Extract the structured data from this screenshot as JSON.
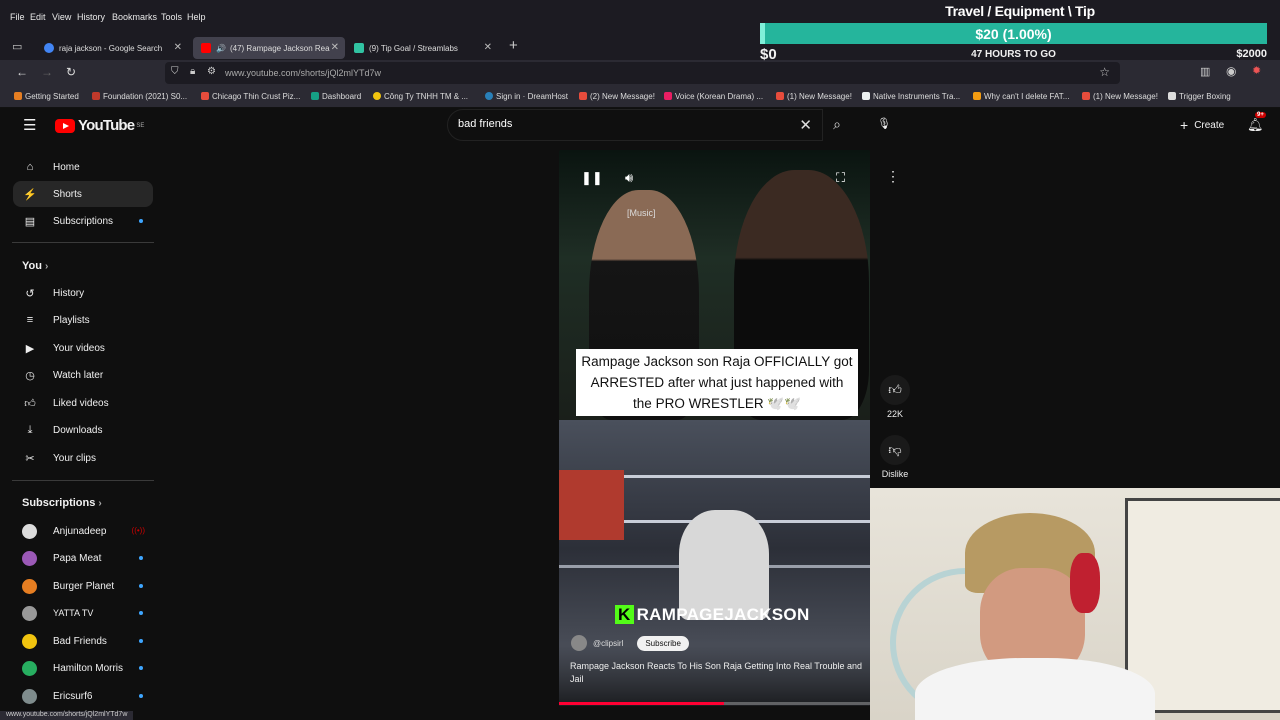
{
  "browser": {
    "menu": [
      "File",
      "Edit",
      "View",
      "History",
      "Bookmarks",
      "Tools",
      "Help"
    ],
    "tabs": [
      {
        "title": "raja jackson - Google Search",
        "active": false
      },
      {
        "title": "(47) Rampage Jackson Rea",
        "active": true
      },
      {
        "title": "(9) Tip Goal / Streamlabs",
        "active": false
      }
    ],
    "url": "www.youtube.com/shorts/jQl2mlYTd7w",
    "bookmarks": [
      "Getting Started",
      "Foundation (2021) S0...",
      "Chicago Thin Crust Piz...",
      "Dashboard",
      "Công Ty TNHH TM & ...",
      "Sign in · DreamHost",
      "(2) New Message!",
      "Voice (Korean Drama) ...",
      "(1) New Message!",
      "Native Instruments Tra...",
      "Why can't I delete FAT...",
      "(1) New Message!",
      "Trigger Boxing"
    ],
    "status_url": "www.youtube.com/shorts/jQl2mlYTd7w"
  },
  "overlay": {
    "title": "Travel / Equipment \\ Tip",
    "amount": "$20 (1.00%)",
    "progress": 0.01,
    "min": "$0",
    "max": "$2000",
    "time_left": "47 HOURS TO GO"
  },
  "header": {
    "logo": "YouTube",
    "logo_region": "SE",
    "search_value": "bad friends",
    "create_label": "Create",
    "notif_count": "9+"
  },
  "sidebar": {
    "main": [
      {
        "label": "Home",
        "icon": "home-icon"
      },
      {
        "label": "Shorts",
        "icon": "shorts-icon"
      },
      {
        "label": "Subscriptions",
        "icon": "subscriptions-icon"
      }
    ],
    "you_label": "You",
    "you_items": [
      {
        "label": "History",
        "icon": "history-icon"
      },
      {
        "label": "Playlists",
        "icon": "playlists-icon"
      },
      {
        "label": "Your videos",
        "icon": "your-videos-icon"
      },
      {
        "label": "Watch later",
        "icon": "watch-later-icon"
      },
      {
        "label": "Liked videos",
        "icon": "liked-videos-icon"
      },
      {
        "label": "Downloads",
        "icon": "downloads-icon"
      },
      {
        "label": "Your clips",
        "icon": "clips-icon"
      }
    ],
    "subs_label": "Subscriptions",
    "subs": [
      {
        "label": "Anjunadeep",
        "color": "#dcdcdc"
      },
      {
        "label": "Papa Meat",
        "color": "#9b59b6"
      },
      {
        "label": "Burger Planet",
        "color": "#e67e22"
      },
      {
        "label": "YATTA TV",
        "color": "#999999"
      },
      {
        "label": "Bad Friends",
        "color": "#f1c40f"
      },
      {
        "label": "Hamilton Morris",
        "color": "#27ae60"
      },
      {
        "label": "Ericsurf6",
        "color": "#7f8c8d"
      }
    ]
  },
  "video": {
    "music_label": "[Music]",
    "caption": "Rampage Jackson son Raja OFFICIALLY got ARRESTED after what just happened with the PRO WRESTLER 🕊️🕊️",
    "watermark": "RAMPAGEJACKSON",
    "channel": "@clipsirl",
    "subscribe_label": "Subscribe",
    "title": "Rampage Jackson Reacts To His Son Raja Getting Into Real Trouble and Jail",
    "progress": 0.53
  },
  "actions": {
    "like_count": "22K",
    "dislike_label": "Dislike"
  }
}
